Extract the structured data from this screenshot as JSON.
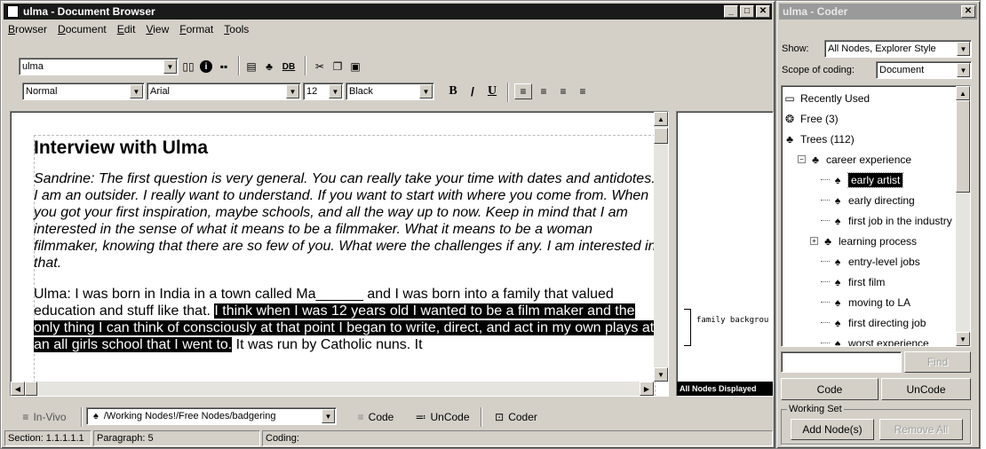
{
  "browser": {
    "title": "ulma - Document Browser",
    "menu": [
      "Browser",
      "Document",
      "Edit",
      "View",
      "Format",
      "Tools"
    ],
    "doc_combo": "ulma",
    "style_combo": "Normal",
    "font_combo": "Arial",
    "size_combo": "12",
    "color_combo": "Black",
    "fmt_bold": "B",
    "fmt_italic": "/",
    "fmt_underline": "U",
    "db_label": "DB",
    "heading": "Interview with Ulma",
    "para1": "Sandrine:  The first question is very general.  You can really take your time with dates and antidotes.  I am an outsider.  I really want to understand. If you want to start with where you come from.  When you got your first inspiration, maybe schools, and all the way up to now.  Keep in mind that I am interested in the sense of what it means to be a filmmaker.  What it means to be a woman filmmaker, knowing that there are so few of you.  What were the challenges if any.  I am interested in that.",
    "para2_plain": "Ulma:  I was born in India in a town called Ma______ and I was born into a family that valued education and stuff like that. ",
    "para2_highlight": "I think when I was 12 years old I wanted to be a film maker and the only thing I can think of consciously at that point I began to write, direct, and act in my own plays at an all girls school that I went to.",
    "para2_tail": " It was run by Catholic nuns.  It",
    "margin_code": "family backgrou",
    "margin_footer": "All Nodes Displayed",
    "invivo_label": "In-Vivo",
    "node_path": "/Working Nodes!/Free Nodes/badgering",
    "code_label": "Code",
    "uncode_label": "UnCode",
    "coder_label": "Coder",
    "status_section": "Section: 1.1.1.1.1",
    "status_paragraph": "Paragraph: 5",
    "status_coding": "Coding:"
  },
  "coder": {
    "title": "ulma - Coder",
    "show_label": "Show:",
    "show_value": "All Nodes, Explorer Style",
    "scope_label": "Scope of coding:",
    "scope_value": "Document",
    "tree": [
      {
        "label": "Recently Used",
        "icon": "folder-icon"
      },
      {
        "label": "Free (3)",
        "icon": "free-nodes-icon"
      },
      {
        "label": "Trees (112)",
        "icon": "tree-nodes-icon"
      },
      {
        "label": "career experience",
        "icon": "tree-node-icon"
      },
      {
        "label": "early artist",
        "icon": "node-icon",
        "selected": true
      },
      {
        "label": "early directing",
        "icon": "node-icon"
      },
      {
        "label": "first job in the industry",
        "icon": "node-icon"
      },
      {
        "label": "learning process",
        "icon": "tree-node-icon"
      },
      {
        "label": "entry-level jobs",
        "icon": "node-icon"
      },
      {
        "label": "first film",
        "icon": "node-icon"
      },
      {
        "label": "moving to LA",
        "icon": "node-icon"
      },
      {
        "label": "first directing job",
        "icon": "node-icon"
      },
      {
        "label": "worst experience",
        "icon": "node-icon"
      }
    ],
    "find_placeholder": "",
    "find_label": "Find",
    "code_label": "Code",
    "uncode_label": "UnCode",
    "working_set_label": "Working Set",
    "add_node_label": "Add Node(s)",
    "remove_all_label": "Remove All"
  }
}
